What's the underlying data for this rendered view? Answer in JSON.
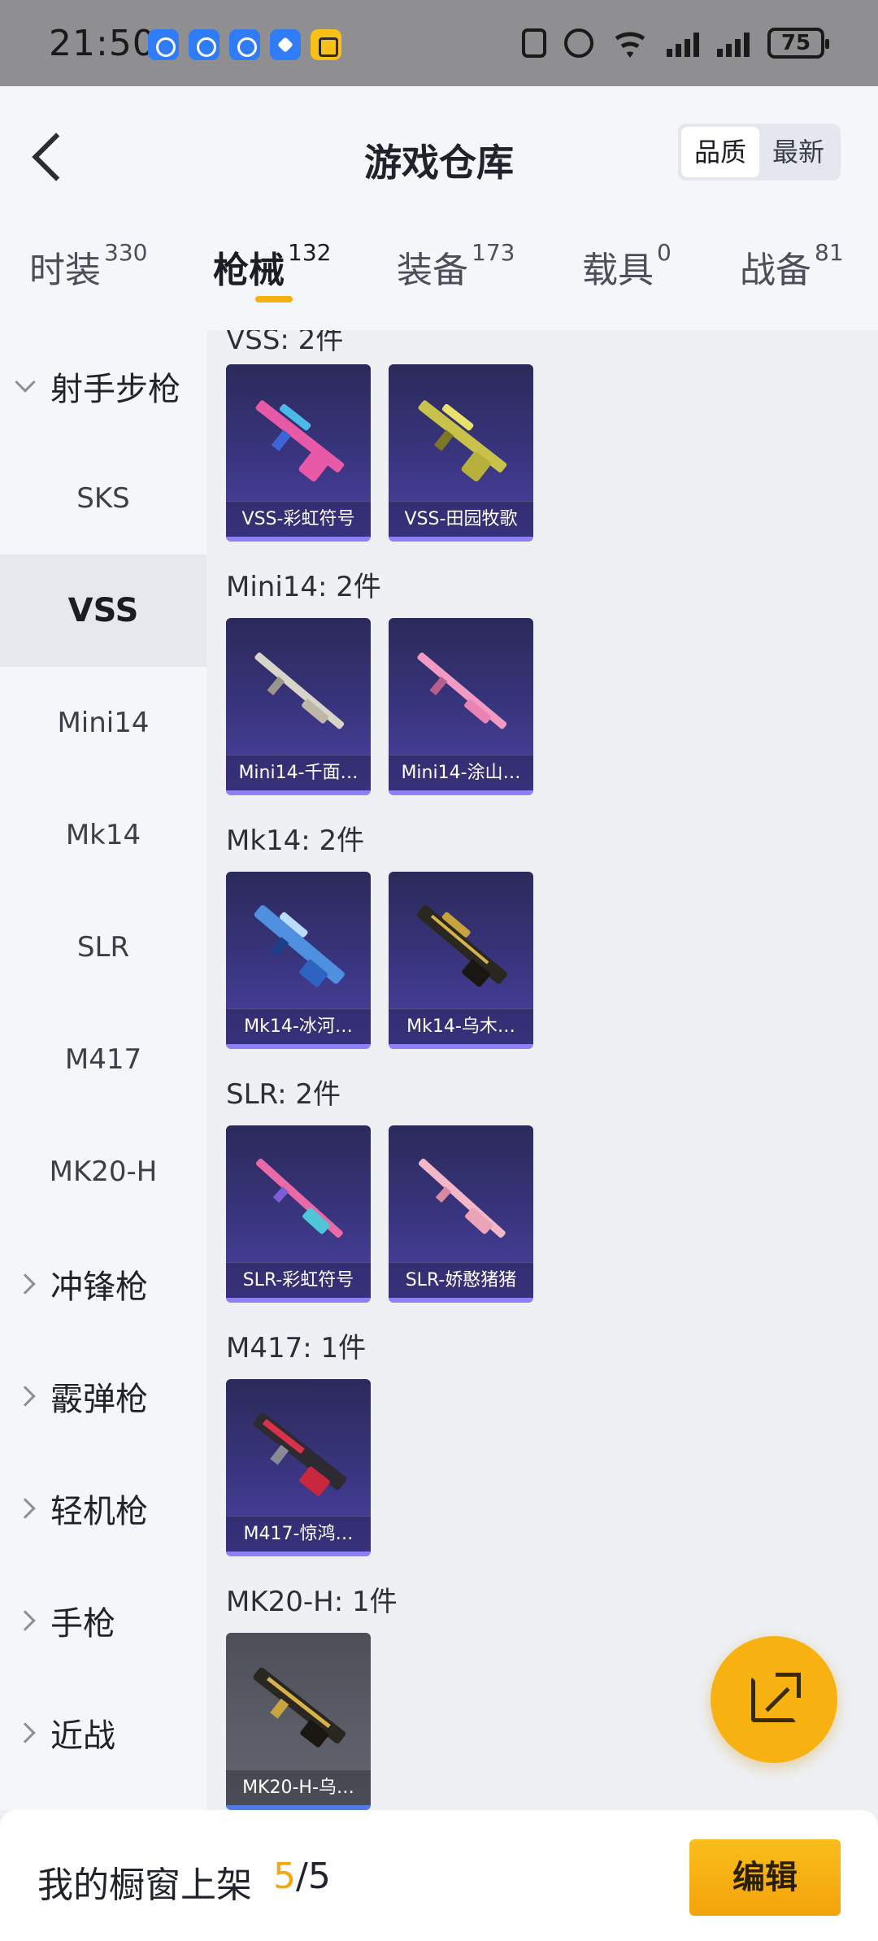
{
  "status_bar": {
    "time": "21:50",
    "battery": "75",
    "icons": [
      "clock-app-icon",
      "clock-app-icon",
      "clock-app-icon",
      "navigation-app-icon",
      "qq-app-icon",
      "nfc-icon",
      "alarm-icon",
      "wifi-icon",
      "signal-icon",
      "signal-icon",
      "battery-icon"
    ]
  },
  "header": {
    "title": "游戏仓库",
    "sort": {
      "quality": "品质",
      "latest": "最新",
      "active": "quality"
    }
  },
  "tabs": [
    {
      "label": "时装",
      "count": "330"
    },
    {
      "label": "枪械",
      "count": "132",
      "active": true
    },
    {
      "label": "装备",
      "count": "173"
    },
    {
      "label": "载具",
      "count": "0"
    },
    {
      "label": "战备",
      "count": "81"
    }
  ],
  "sidebar": {
    "group_open": "射手步枪",
    "items": [
      "SKS",
      "VSS",
      "Mini14",
      "Mk14",
      "SLR",
      "M417",
      "MK20-H"
    ],
    "selected": "VSS",
    "groups": [
      "冲锋枪",
      "霰弹枪",
      "轻机枪",
      "手枪",
      "近战"
    ]
  },
  "sections": [
    {
      "label": "VSS: 2件",
      "items": [
        {
          "name": "VSS-彩虹符号"
        },
        {
          "name": "VSS-田园牧歌"
        }
      ]
    },
    {
      "label": "Mini14: 2件",
      "items": [
        {
          "name": "Mini14-千面…"
        },
        {
          "name": "Mini14-涂山…"
        }
      ]
    },
    {
      "label": "Mk14: 2件",
      "items": [
        {
          "name": "Mk14-冰河…"
        },
        {
          "name": "Mk14-乌木…"
        }
      ]
    },
    {
      "label": "SLR: 2件",
      "items": [
        {
          "name": "SLR-彩虹符号"
        },
        {
          "name": "SLR-娇憨猪猪"
        }
      ]
    },
    {
      "label": "M417: 1件",
      "items": [
        {
          "name": "M417-惊鸿…"
        }
      ]
    },
    {
      "label": "MK20-H: 1件",
      "items": [
        {
          "name": "MK20-H-乌…"
        }
      ]
    }
  ],
  "colors": {
    "accent": "#f5b10e",
    "card_purple": "#3a3580",
    "card_gray": "#5b5e68"
  },
  "bottom": {
    "label": "我的橱窗上架",
    "current": "5",
    "separator": "/",
    "total": "5",
    "edit": "编辑"
  }
}
